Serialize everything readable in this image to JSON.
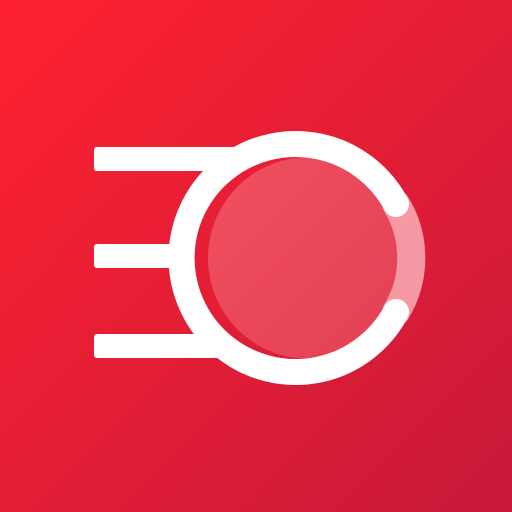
{
  "icon": {
    "name": "app-logo-icon",
    "colors": {
      "background_start": "#FF2230",
      "background_end": "#C7193A",
      "foreground": "#FFFFFF",
      "inner_disc_start": "#F0505F",
      "inner_disc_end": "#E23F54",
      "arc_highlight": "#F59AA4"
    }
  }
}
